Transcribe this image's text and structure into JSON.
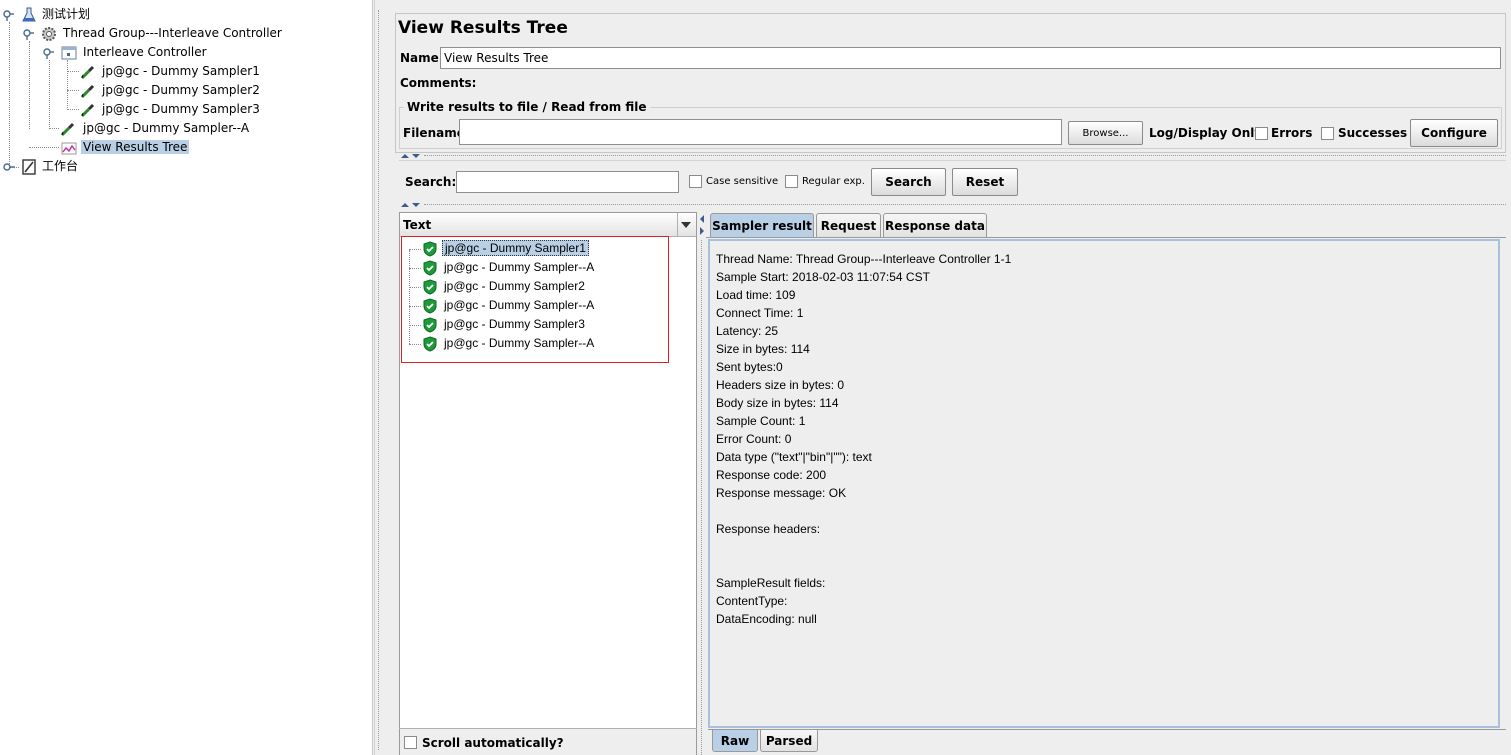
{
  "tree": {
    "root": "测试计划",
    "thread_group": "Thread Group---Interleave Controller",
    "interleave_controller": "Interleave Controller",
    "sampler1": "jp@gc - Dummy Sampler1",
    "sampler2": "jp@gc - Dummy Sampler2",
    "sampler3": "jp@gc - Dummy Sampler3",
    "sampler_a": "jp@gc - Dummy Sampler--A",
    "view_results_tree": "View Results Tree",
    "workbench": "工作台"
  },
  "panel": {
    "title": "View Results Tree",
    "name_label": "Name:",
    "name_value": "View Results Tree",
    "comments_label": "Comments:",
    "file_group_title": "Write results to file / Read from file",
    "filename_label": "Filename",
    "filename_value": "",
    "browse_label": "Browse...",
    "log_display_label": "Log/Display Only:",
    "errors_label": "Errors",
    "successes_label": "Successes",
    "configure_label": "Configure"
  },
  "search": {
    "label": "Search:",
    "value": "",
    "case_sensitive_label": "Case sensitive",
    "regular_exp_label": "Regular exp.",
    "search_button": "Search",
    "reset_button": "Reset"
  },
  "results": {
    "renderer_selected": "Text",
    "items": [
      "jp@gc - Dummy Sampler1",
      "jp@gc - Dummy Sampler--A",
      "jp@gc - Dummy Sampler2",
      "jp@gc - Dummy Sampler--A",
      "jp@gc - Dummy Sampler3",
      "jp@gc - Dummy Sampler--A"
    ],
    "scroll_auto_label": "Scroll automatically?"
  },
  "tabs": {
    "sampler_result": "Sampler result",
    "request": "Request",
    "response_data": "Response data"
  },
  "sampler_result": {
    "lines": [
      "Thread Name: Thread Group---Interleave Controller 1-1",
      "Sample Start: 2018-02-03 11:07:54 CST",
      "Load time: 109",
      "Connect Time: 1",
      "Latency: 25",
      "Size in bytes: 114",
      "Sent bytes:0",
      "Headers size in bytes: 0",
      "Body size in bytes: 114",
      "Sample Count: 1",
      "Error Count: 0",
      "Data type (\"text\"|\"bin\"|\"\"): text",
      "Response code: 200",
      "Response message: OK",
      "",
      "Response headers:",
      "",
      "",
      "SampleResult fields:",
      "ContentType:",
      "DataEncoding: null"
    ]
  },
  "bottom_tabs": {
    "raw": "Raw",
    "parsed": "Parsed"
  },
  "colors": {
    "selection": "#b8cfe5",
    "highlight_box": "#e02020",
    "success_green": "#1d9a3a"
  }
}
